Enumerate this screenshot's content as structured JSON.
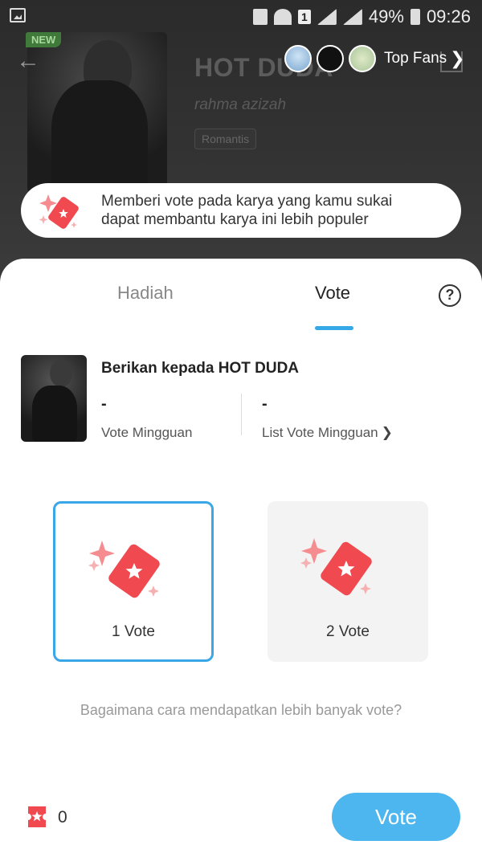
{
  "status_bar": {
    "battery": "49%",
    "time": "09:26",
    "sim_badge": "1"
  },
  "hero": {
    "new_badge": "NEW",
    "title": "HOT DUDA",
    "author": "rahma azizah",
    "tag": "Romantis"
  },
  "top_fans": {
    "label": "Top Fans"
  },
  "banner": {
    "line1": "Memberi vote pada karya yang kamu sukai",
    "line2": "dapat membantu karya ini lebih populer"
  },
  "tabs": [
    {
      "label": "Hadiah",
      "active": false
    },
    {
      "label": "Vote",
      "active": true
    }
  ],
  "help": "?",
  "book": {
    "give_label": "Berikan kepada HOT DUDA",
    "weekly_vote_value": "-",
    "weekly_vote_label": "Vote Mingguan",
    "weekly_list_value": "-",
    "weekly_list_label": "List Vote Mingguan"
  },
  "options": [
    {
      "label": "1 Vote",
      "selected": true
    },
    {
      "label": "2 Vote",
      "selected": false
    }
  ],
  "howto": "Bagaimana cara mendapatkan lebih banyak vote?",
  "balance": {
    "count": "0"
  },
  "vote_button": "Vote",
  "colors": {
    "accent": "#4db6ee",
    "ticket": "#f0494f",
    "selected_border": "#3aa7e6"
  }
}
